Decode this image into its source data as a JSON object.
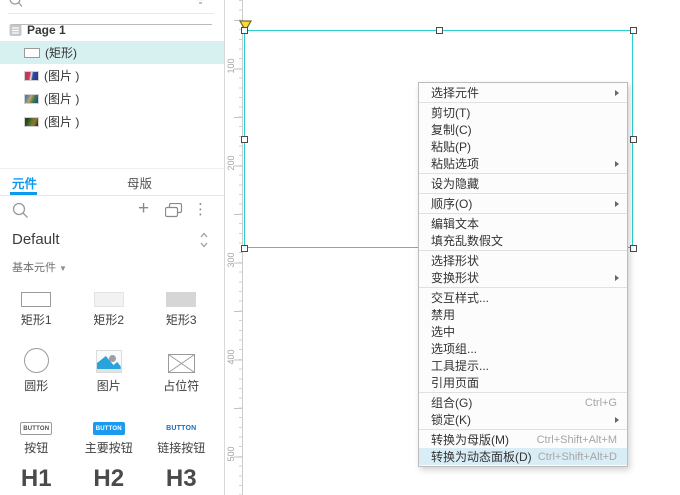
{
  "colors": {
    "selection_cyan": "#2ccfd0",
    "accent_blue": "#0b9af0",
    "outline_highlight": "#d7f1f1",
    "menu_highlight": "#d8edf6",
    "primary_button_blue": "#1a9bef",
    "link_button_blue": "#1670c0"
  },
  "outline": {
    "page_label": "Page 1",
    "items": [
      {
        "label": "(矩形)",
        "type": "rectangle",
        "selected": true
      },
      {
        "label": "(图片 )",
        "type": "image"
      },
      {
        "label": "(图片 )",
        "type": "image"
      },
      {
        "label": "(图片 )",
        "type": "image"
      }
    ]
  },
  "panel": {
    "tabs": [
      {
        "label": "元件",
        "active": true
      },
      {
        "label": "母版",
        "active": false
      }
    ],
    "toolbar": {
      "plus_glyph": "+",
      "kebab_glyph": "⋮"
    },
    "library_selector": {
      "value": "Default"
    },
    "section_label": "基本元件",
    "section_caret": "▼",
    "widgets": [
      {
        "label": "矩形1"
      },
      {
        "label": "矩形2"
      },
      {
        "label": "矩形3"
      },
      {
        "label": "圆形"
      },
      {
        "label": "图片"
      },
      {
        "label": "占位符"
      },
      {
        "label": "按钮",
        "button_text": "BUTTON"
      },
      {
        "label": "主要按钮",
        "button_text": "BUTTON"
      },
      {
        "label": "链接按钮",
        "button_text": "BUTTON"
      },
      {
        "label": "H1"
      },
      {
        "label": "H2"
      },
      {
        "label": "H3"
      }
    ]
  },
  "ruler": {
    "labels": [
      "100",
      "200",
      "300",
      "400",
      "500"
    ]
  },
  "context_menu": {
    "items": [
      {
        "label": "选择元件",
        "submenu": true
      },
      {
        "separator": true
      },
      {
        "label": "剪切(T)"
      },
      {
        "label": "复制(C)"
      },
      {
        "label": "粘贴(P)"
      },
      {
        "label": "粘贴选项",
        "submenu": true
      },
      {
        "separator": true
      },
      {
        "label": "设为隐藏"
      },
      {
        "separator": true
      },
      {
        "label": "顺序(O)",
        "submenu": true
      },
      {
        "separator": true
      },
      {
        "label": "编辑文本"
      },
      {
        "label": "填充乱数假文"
      },
      {
        "separator": true
      },
      {
        "label": "选择形状"
      },
      {
        "label": "变换形状",
        "submenu": true
      },
      {
        "separator": true
      },
      {
        "label": "交互样式..."
      },
      {
        "label": "禁用"
      },
      {
        "label": "选中"
      },
      {
        "label": "选项组..."
      },
      {
        "label": "工具提示..."
      },
      {
        "label": "引用页面"
      },
      {
        "separator": true
      },
      {
        "label": "组合(G)",
        "shortcut": "Ctrl+G"
      },
      {
        "label": "锁定(K)",
        "submenu": true
      },
      {
        "separator": true
      },
      {
        "label": "转换为母版(M)",
        "shortcut": "Ctrl+Shift+Alt+M"
      },
      {
        "label": "转换为动态面板(D)",
        "shortcut": "Ctrl+Shift+Alt+D",
        "highlighted": true
      }
    ]
  }
}
